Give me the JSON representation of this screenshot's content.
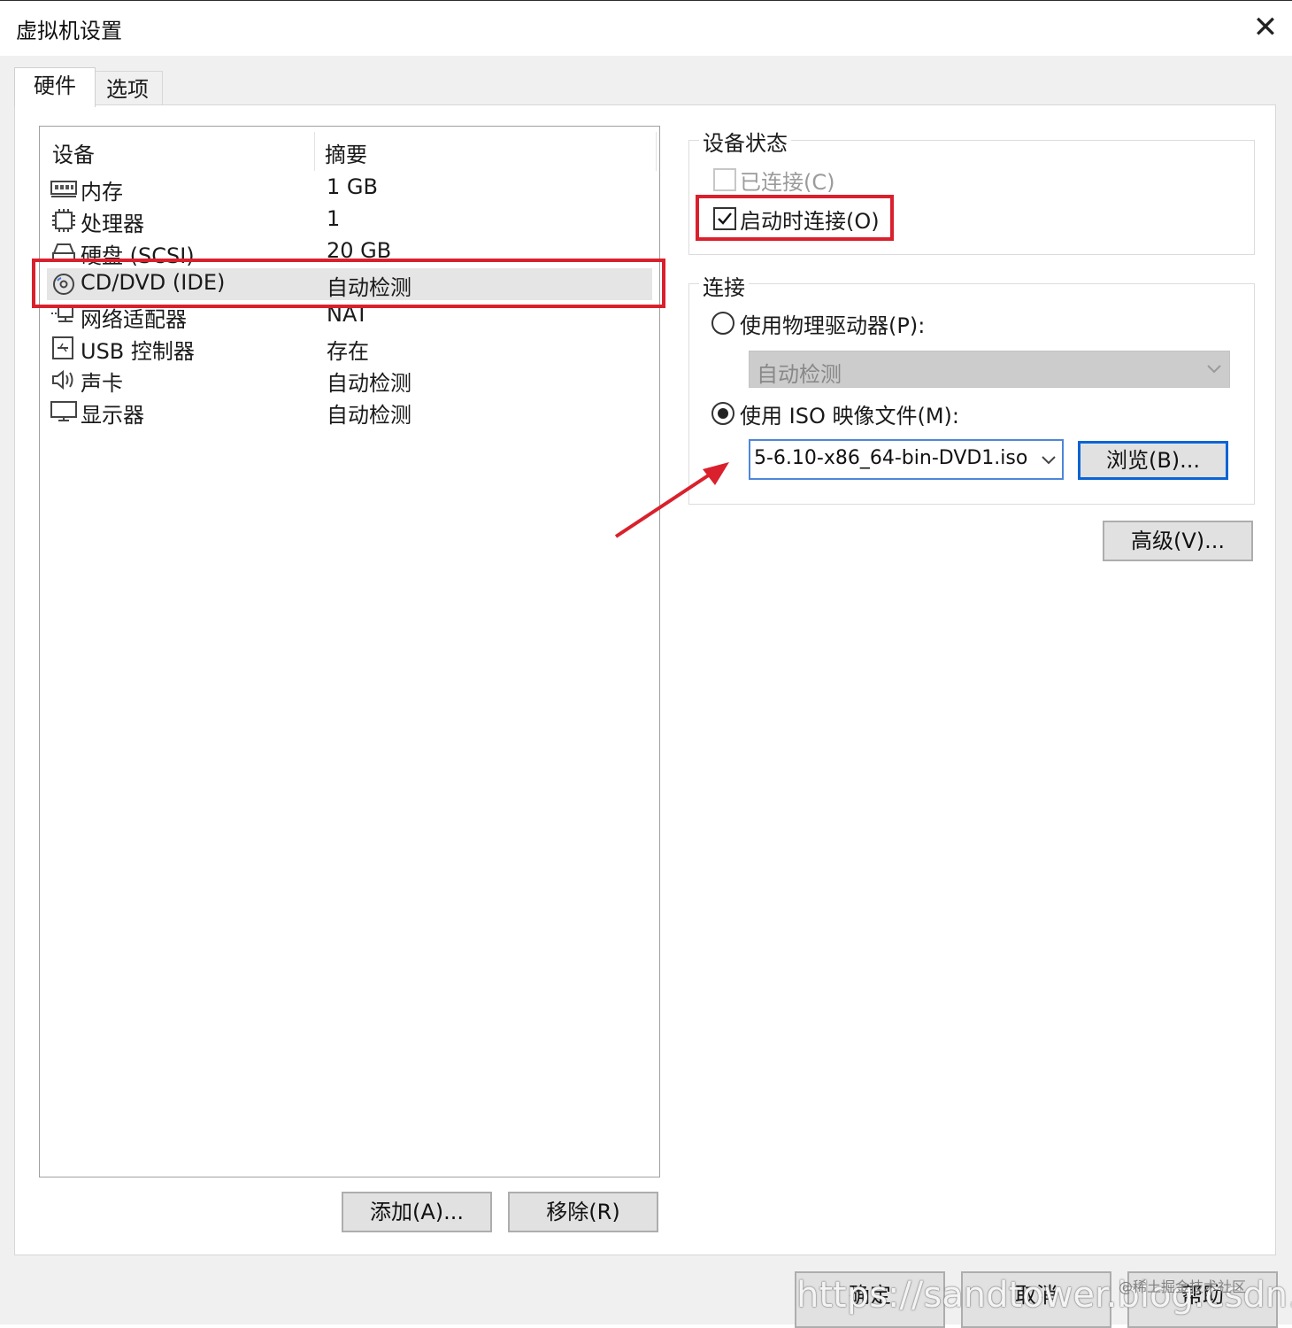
{
  "window": {
    "title": "虚拟机设置",
    "close": "✕"
  },
  "tabs": [
    {
      "label": "硬件",
      "active": true
    },
    {
      "label": "选项",
      "active": false
    }
  ],
  "device_list": {
    "headers": {
      "device": "设备",
      "summary": "摘要"
    },
    "rows": [
      {
        "name": "内存",
        "summary": "1 GB",
        "icon": "memory-icon"
      },
      {
        "name": "处理器",
        "summary": "1",
        "icon": "processor-icon"
      },
      {
        "name": "硬盘 (SCSI)",
        "summary": "20 GB",
        "icon": "hard-disk-icon"
      },
      {
        "name": "CD/DVD (IDE)",
        "summary": "自动检测",
        "icon": "cd-dvd-icon",
        "selected": true
      },
      {
        "name": "网络适配器",
        "summary": "NAT",
        "icon": "network-adapter-icon"
      },
      {
        "name": "USB 控制器",
        "summary": "存在",
        "icon": "usb-controller-icon"
      },
      {
        "name": "声卡",
        "summary": "自动检测",
        "icon": "sound-card-icon"
      },
      {
        "name": "显示器",
        "summary": "自动检测",
        "icon": "display-icon"
      }
    ],
    "add_button": "添加(A)...",
    "remove_button": "移除(R)"
  },
  "device_status": {
    "title": "设备状态",
    "connected": {
      "label": "已连接(C)",
      "checked": false,
      "disabled": true
    },
    "connect_at_power_on": {
      "label": "启动时连接(O)",
      "checked": true
    }
  },
  "connection": {
    "title": "连接",
    "physical_drive": {
      "label": "使用物理驱动器(P):",
      "selected": false,
      "value": "自动检测"
    },
    "iso_image": {
      "label": "使用 ISO 映像文件(M):",
      "selected": true,
      "value": "5-6.10-x86_64-bin-DVD1.iso"
    },
    "browse_button": "浏览(B)...",
    "advanced_button": "高级(V)..."
  },
  "footer": {
    "ok": "确定",
    "cancel": "取消",
    "help": "帮助"
  },
  "watermark": {
    "url": "https://sandtower.blog.csdn.net",
    "community": "@稀土掘金技术社区"
  },
  "colors": {
    "highlight": "#d9202c",
    "selection": "#e5e5e5",
    "primary_border": "#0a64d6"
  }
}
